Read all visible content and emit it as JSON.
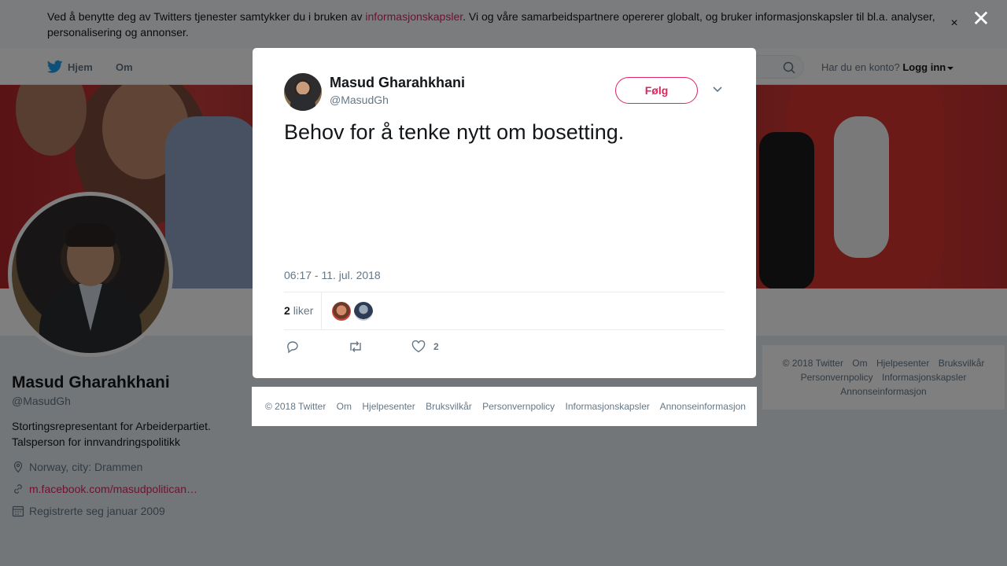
{
  "cookie_banner": {
    "text_before": "Ved å benytte deg av Twitters tjenester samtykker du i bruken av ",
    "link": "informasjonskapsler",
    "text_after": ". Vi og våre samarbeidspartnere opererer globalt, og bruker informasjonskapsler til bl.a. analyser, personalisering og annonser.",
    "close_glyph": "×"
  },
  "close_modal_glyph": "✕",
  "nav": {
    "home": "Hjem",
    "about": "Om",
    "account_prompt": "Har du en konto?",
    "login": "Logg inn"
  },
  "profile": {
    "name": "Masud Gharahkhani",
    "handle": "@MasudGh",
    "bio_line1": "Stortingsrepresentant for Arbeiderpartiet.",
    "bio_line2": "Talsperson for innvandringspolitikk",
    "location": "Norway, city: Drammen",
    "url": "m.facebook.com/masudpolitican…",
    "joined": "Registrerte seg januar 2009"
  },
  "right_footer": {
    "items": [
      "© 2018 Twitter",
      "Om",
      "Hjelpesenter",
      "Bruksvilkår",
      "Personvernpolicy",
      "Informasjonskapsler",
      "Annonseinformasjon"
    ]
  },
  "tweet": {
    "name": "Masud Gharahkhani",
    "handle": "@MasudGh",
    "follow_label": "Følg",
    "text": "Behov for å tenke nytt om bosetting.",
    "timestamp": "06:17 - 11. jul. 2018",
    "likes_count": "2",
    "likes_label": "liker",
    "like_action_count": "2"
  },
  "modal_footer": {
    "items": [
      "© 2018 Twitter",
      "Om",
      "Hjelpesenter",
      "Bruksvilkår",
      "Personvernpolicy",
      "Informasjonskapsler",
      "Annonseinformasjon"
    ]
  },
  "colors": {
    "accent": "#e0245e",
    "twitter_blue": "#1da1f2",
    "text_secondary": "#657786"
  }
}
